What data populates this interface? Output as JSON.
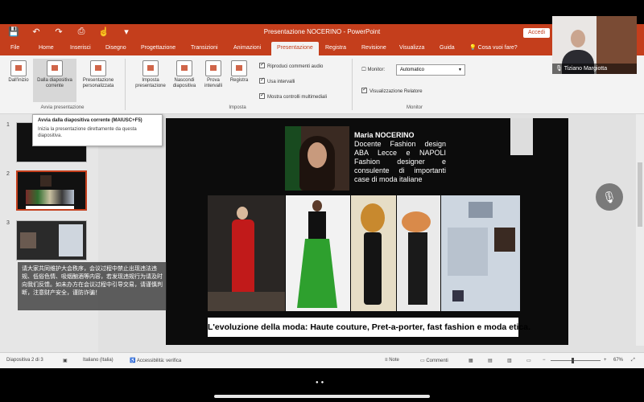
{
  "app": {
    "title": "Presentazione NOCERINO  -  PowerPoint",
    "signin": "Accedi"
  },
  "tabs": {
    "items": [
      "File",
      "Home",
      "Inserisci",
      "Disegno",
      "Progettazione",
      "Transizioni",
      "Animazioni",
      "Presentazione",
      "Registra",
      "Revisione",
      "Visualizza",
      "Guida"
    ],
    "active": "Presentazione",
    "tell_me": "Cosa vuoi fare?"
  },
  "ribbon": {
    "from_start": "Dall'inizio",
    "from_current": "Dalla diapositiva corrente",
    "custom": "Presentazione personalizzata",
    "group_start": "Avvia presentazione",
    "setup": "Imposta presentazione",
    "hide": "Nascondi diapositiva",
    "rehearse": "Prova intervalli",
    "record": "Registra",
    "chk_narration": "Riproduci commenti audio",
    "chk_timings": "Usa intervalli",
    "chk_media": "Mostra controlli multimediali",
    "group_setup": "Imposta",
    "monitor_label": "Monitor:",
    "monitor_value": "Automatico",
    "chk_presenter": "Visualizzazione Relatore",
    "group_monitor": "Monitor"
  },
  "tooltip": {
    "title": "Avvia dalla diapositiva corrente (MAIUSC+F5)",
    "body": "Inizia la presentazione direttamente da questa diapositiva."
  },
  "webcam": {
    "name": "Tiziano Margiotta"
  },
  "thumbnails": {
    "numbers": [
      "1",
      "2",
      "3"
    ]
  },
  "chat_overlay": {
    "text": "请大家共同维护大会秩序，会议过程中禁止出现违法违规、低俗色情、吸烟酗酒等内容，若发现违规行为请及时向我们反馈。如未办方在会议过程中引导交易，请谨慎判断，注意财产安全，谨防诈骗！"
  },
  "slide": {
    "name": "Maria NOCERINO",
    "bio": "Docente Fashion design ABA Lecce e NAPOLI Fashion designer e consulente di importanti case di moda italiane",
    "caption": "L'evoluzione della moda: Haute couture, Pret-a-porter,  fast fashion e moda etica."
  },
  "statusbar": {
    "slide_count": "Diapositiva 2 di 3",
    "language": "Italiano (Italia)",
    "accessibility": "Accessibilità: verifica",
    "notes": "Note",
    "comments": "Commenti",
    "zoom": "67%"
  }
}
